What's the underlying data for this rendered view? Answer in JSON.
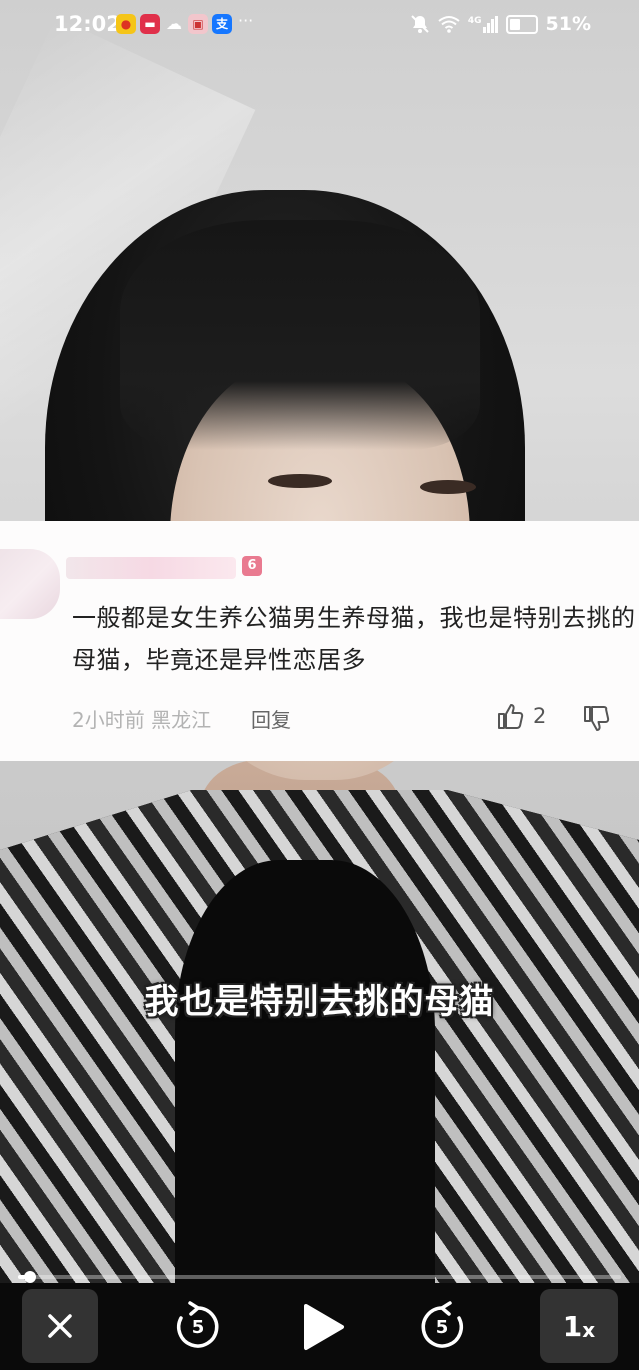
{
  "status_bar": {
    "time": "12:02",
    "more_indicator": "···",
    "network": "4G",
    "battery_percent": "51%",
    "battery_level": 0.51
  },
  "video": {
    "subtitle": "我也是特别去挑的母猫"
  },
  "comment": {
    "level_badge": "6",
    "text": "一般都是女生养公猫男生养母猫，我也是特别去挑的母猫，毕竟还是异性恋居多",
    "time_location": "2小时前 黑龙江",
    "reply_label": "回复",
    "like_count": "2"
  },
  "player": {
    "skip_back_seconds": "5",
    "skip_forward_seconds": "5",
    "speed_value": "1",
    "speed_suffix": "x",
    "progress": 0.02
  },
  "colors": {
    "badge": "#e97a90",
    "control_bar": "#0a0a0a",
    "control_button": "#333333"
  }
}
